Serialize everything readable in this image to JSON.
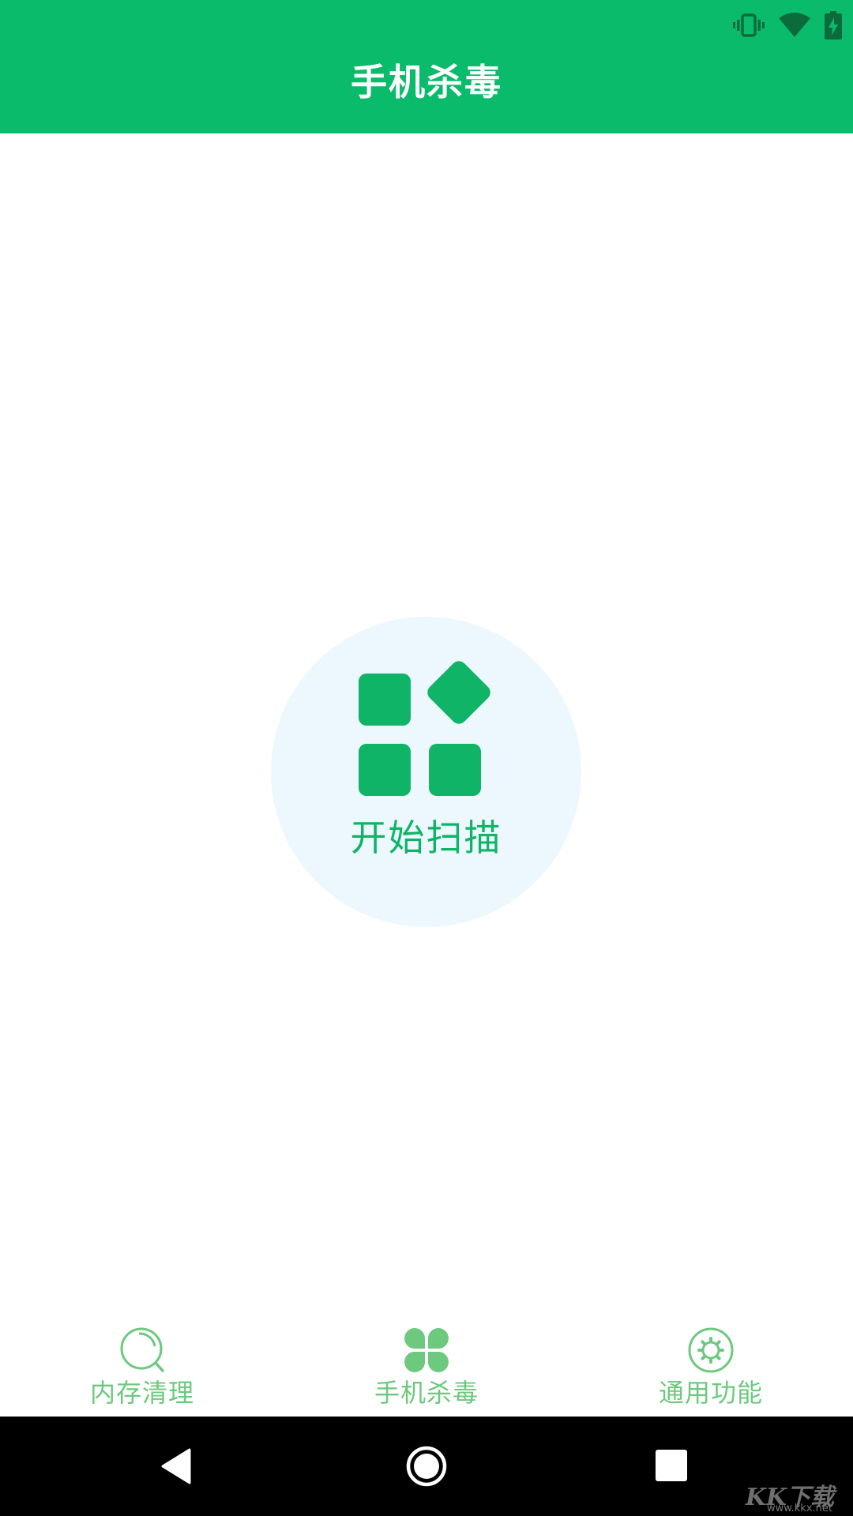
{
  "status_bar": {
    "icons": [
      "vibrate-icon",
      "wifi-icon",
      "battery-charging-icon"
    ]
  },
  "header": {
    "title": "手机杀毒",
    "background_color": "#09bb6a"
  },
  "scan": {
    "button_label": "开始扫描",
    "icon": "apps-grid-icon",
    "accent_color": "#10b466",
    "circle_color": "#ecf8fd"
  },
  "tabbar": {
    "tabs": [
      {
        "label": "内存清理",
        "icon": "search-icon"
      },
      {
        "label": "手机杀毒",
        "icon": "clover-icon"
      },
      {
        "label": "通用功能",
        "icon": "settings-gear-icon"
      }
    ],
    "color": "#6cc97d"
  },
  "navbar": {
    "buttons": [
      "back-icon",
      "home-icon",
      "recents-icon"
    ]
  },
  "watermark": {
    "text": "KK下载",
    "url": "www.kkx.net"
  }
}
